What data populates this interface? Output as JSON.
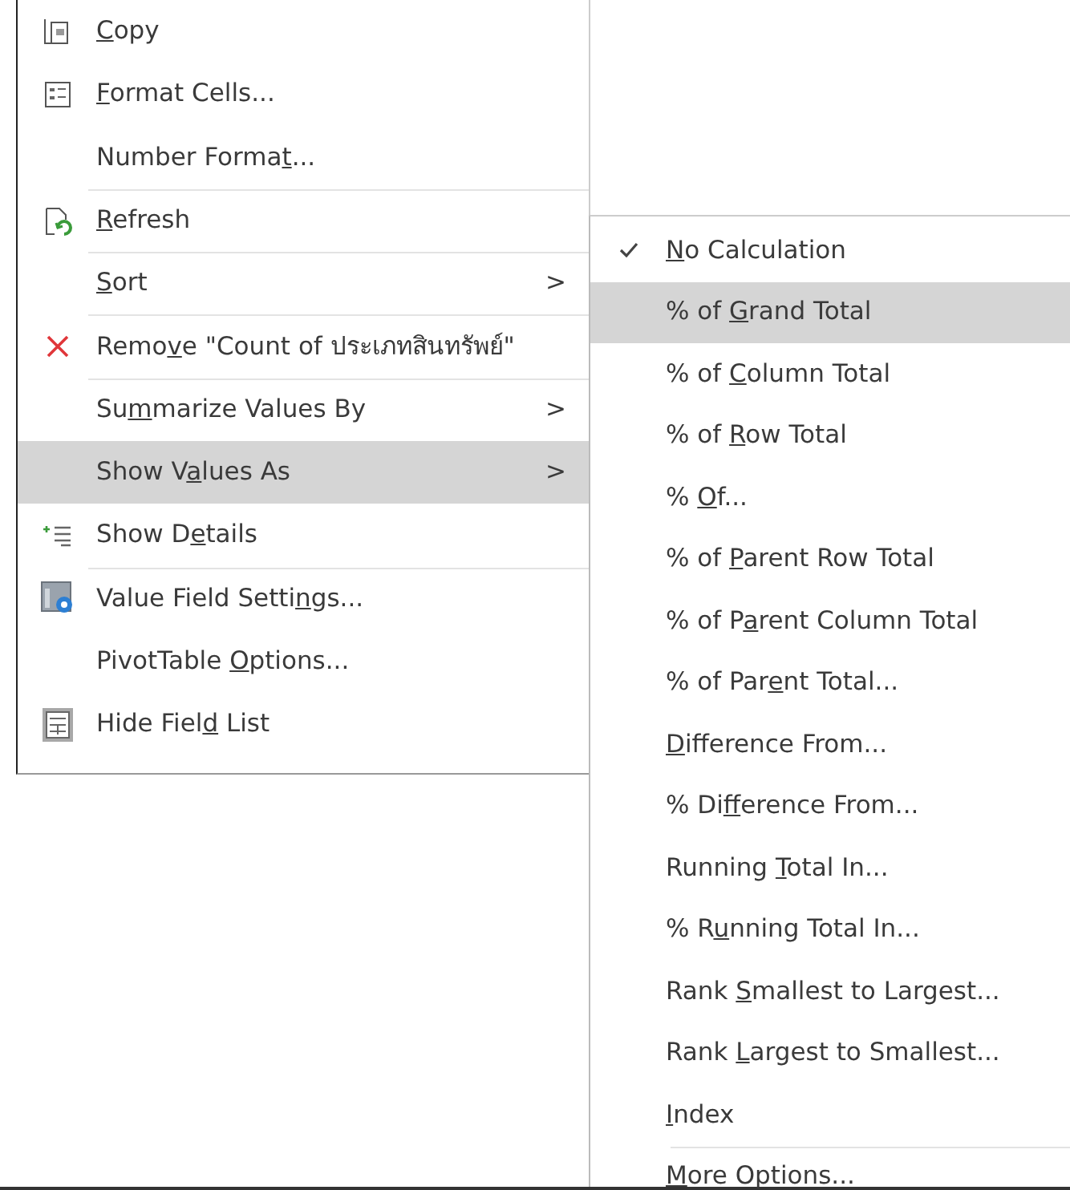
{
  "context_menu": {
    "items": [
      {
        "key": "C",
        "post": "opy",
        "separator_before": false,
        "selected": false
      },
      {
        "key": "F",
        "post": "ormat Cells...",
        "separator_before": false,
        "selected": false
      },
      {
        "pre": "Number Forma",
        "key": "t",
        "post": "...",
        "separator_before": false,
        "selected": false
      },
      {
        "key": "R",
        "post": "efresh",
        "separator_before": true,
        "selected": false
      },
      {
        "key": "S",
        "post": "ort",
        "arrow": ">",
        "separator_before": true,
        "selected": false
      },
      {
        "pre": "Remo",
        "key": "v",
        "post": "e \"Count of ประเภทสินทรัพย์\"",
        "separator_before": true,
        "selected": false
      },
      {
        "pre": "Su",
        "key": "m",
        "post": "marize Values By",
        "arrow": ">",
        "separator_before": true,
        "selected": false
      },
      {
        "pre": "Show V",
        "key": "a",
        "post": "lues As",
        "arrow": ">",
        "separator_before": false,
        "selected": true
      },
      {
        "pre": "Show D",
        "key": "e",
        "post": "tails",
        "separator_before": false,
        "selected": false
      },
      {
        "pre": "Value Field Setti",
        "key": "n",
        "post": "gs...",
        "separator_before": true,
        "selected": false
      },
      {
        "pre": "PivotTable ",
        "key": "O",
        "post": "ptions...",
        "separator_before": false,
        "selected": false
      },
      {
        "pre": "Hide Fiel",
        "key": "d",
        "post": " List",
        "separator_before": false,
        "selected": false
      }
    ]
  },
  "submenu": {
    "items": [
      {
        "key": "N",
        "post": "o Calculation",
        "checked": true,
        "selected": false,
        "separator_before": false
      },
      {
        "pre": "% of ",
        "key": "G",
        "post": "rand Total",
        "checked": false,
        "selected": true,
        "separator_before": false
      },
      {
        "pre": "% of ",
        "key": "C",
        "post": "olumn Total",
        "checked": false,
        "selected": false,
        "separator_before": false
      },
      {
        "pre": "% of ",
        "key": "R",
        "post": "ow Total",
        "checked": false,
        "selected": false,
        "separator_before": false
      },
      {
        "pre": "% ",
        "key": "O",
        "post": "f...",
        "checked": false,
        "selected": false,
        "separator_before": false
      },
      {
        "pre": "% of ",
        "key": "P",
        "post": "arent Row Total",
        "checked": false,
        "selected": false,
        "separator_before": false
      },
      {
        "pre": "% of P",
        "key": "a",
        "post": "rent Column Total",
        "checked": false,
        "selected": false,
        "separator_before": false
      },
      {
        "pre": "% of Par",
        "key": "e",
        "post": "nt Total...",
        "checked": false,
        "selected": false,
        "separator_before": false
      },
      {
        "key": "D",
        "post": "ifference From...",
        "checked": false,
        "selected": false,
        "separator_before": false
      },
      {
        "pre": "% Di",
        "key": "f",
        "post": "ference From...",
        "checked": false,
        "selected": false,
        "separator_before": false
      },
      {
        "pre": "Running ",
        "key": "T",
        "post": "otal In...",
        "checked": false,
        "selected": false,
        "separator_before": false
      },
      {
        "pre": "% R",
        "key": "u",
        "post": "nning Total In...",
        "checked": false,
        "selected": false,
        "separator_before": false
      },
      {
        "pre": "Rank ",
        "key": "S",
        "post": "mallest to Largest...",
        "checked": false,
        "selected": false,
        "separator_before": false
      },
      {
        "pre": "Rank ",
        "key": "L",
        "post": "argest to Smallest...",
        "checked": false,
        "selected": false,
        "separator_before": false
      },
      {
        "key": "I",
        "post": "ndex",
        "checked": false,
        "selected": false,
        "separator_before": false
      },
      {
        "key": "M",
        "post": "ore Options...",
        "checked": false,
        "selected": false,
        "separator_before": true
      }
    ]
  }
}
